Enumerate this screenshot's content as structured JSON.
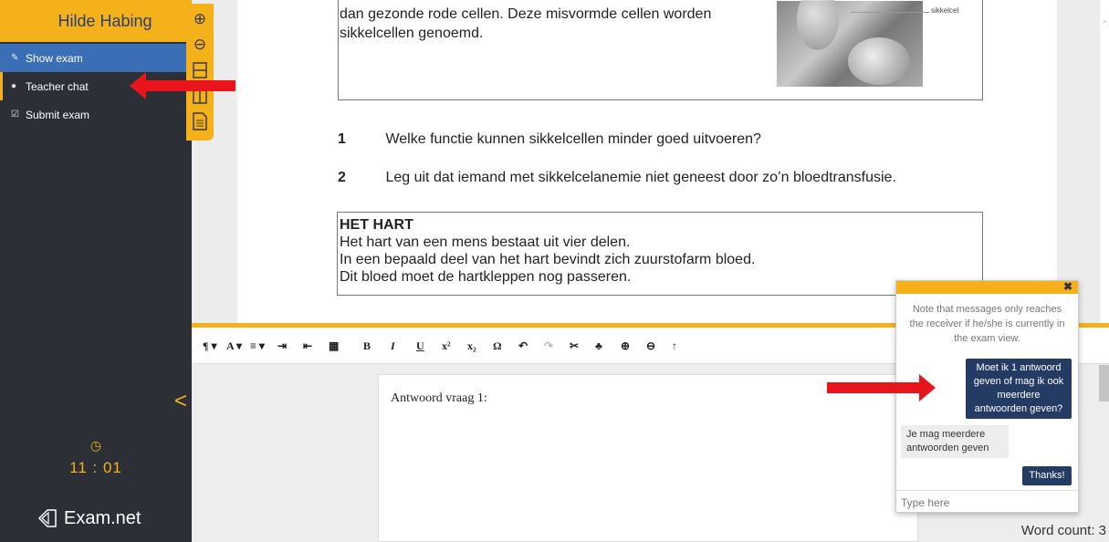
{
  "sidebar": {
    "student_name": "Hilde Habing",
    "menu": [
      {
        "label": "Show exam",
        "icon": "edit-icon"
      },
      {
        "label": "Teacher chat",
        "icon": "chat-icon"
      },
      {
        "label": "Submit exam",
        "icon": "check-square-icon"
      }
    ],
    "timer": "11 : 01",
    "logo_text": "Exam.net"
  },
  "zoom_toolbar": [
    "zoom-in-icon",
    "zoom-out-icon",
    "split-horizontal-icon",
    "split-vertical-icon",
    "document-icon"
  ],
  "exam": {
    "box1_text": "dan gezonde rode cellen. Deze misvormde cellen worden sikkelcellen genoemd.",
    "image_label": "sikkelcel",
    "questions": [
      {
        "num": "1",
        "text": "Welke functie kunnen sikkelcellen minder goed uitvoeren?"
      },
      {
        "num": "2",
        "text": "Leg uit dat iemand met sikkelcelanemie niet geneest door zo’n bloedtransfusie."
      }
    ],
    "box2_title": "HET HART",
    "box2_lines": [
      "Het hart van een mens bestaat uit vier delen.",
      "In een bepaald deel van het hart bevindt zich zuurstofarm bloed.",
      "Dit bloed moet de hartkleppen nog passeren."
    ]
  },
  "editor": {
    "toolbar": [
      {
        "name": "paragraph-format",
        "label": "¶ ▾"
      },
      {
        "name": "font-size",
        "label": "A ▾"
      },
      {
        "name": "align",
        "label": "≡ ▾"
      },
      {
        "name": "indent",
        "label": "⇥"
      },
      {
        "name": "outdent",
        "label": "⇤"
      },
      {
        "name": "table",
        "label": "▦"
      },
      {
        "name": "bold",
        "label": "B"
      },
      {
        "name": "italic",
        "label": "I"
      },
      {
        "name": "underline",
        "label": "U"
      },
      {
        "name": "superscript",
        "label": "x²"
      },
      {
        "name": "subscript",
        "label": "x₂"
      },
      {
        "name": "special-char",
        "label": "Ω"
      },
      {
        "name": "undo",
        "label": "↶"
      },
      {
        "name": "redo",
        "label": "↷"
      },
      {
        "name": "cut",
        "label": "✂"
      },
      {
        "name": "spellcheck",
        "label": "♣"
      },
      {
        "name": "zoom-in",
        "label": "⊕"
      },
      {
        "name": "zoom-out",
        "label": "⊖"
      },
      {
        "name": "up",
        "label": "↑"
      }
    ],
    "answer_text": "Antwoord vraag 1:",
    "word_count": "Word count: 3"
  },
  "chat": {
    "note": "Note that messages only reaches the receiver if he/she is currently in the exam view.",
    "messages": [
      {
        "from": "student",
        "text": "Moet ik 1 antwoord geven of mag ik ook meerdere antwoorden geven?"
      },
      {
        "from": "teacher",
        "text": "Je mag meerdere antwoorden geven"
      },
      {
        "from": "student",
        "text": "Thanks!"
      }
    ],
    "input_placeholder": "Type here"
  },
  "colors": {
    "accent": "#f5b11a",
    "sidebar": "#2c2f36",
    "active": "#3a6fb5",
    "chat_out": "#243b63",
    "annotation": "#e8151c"
  }
}
